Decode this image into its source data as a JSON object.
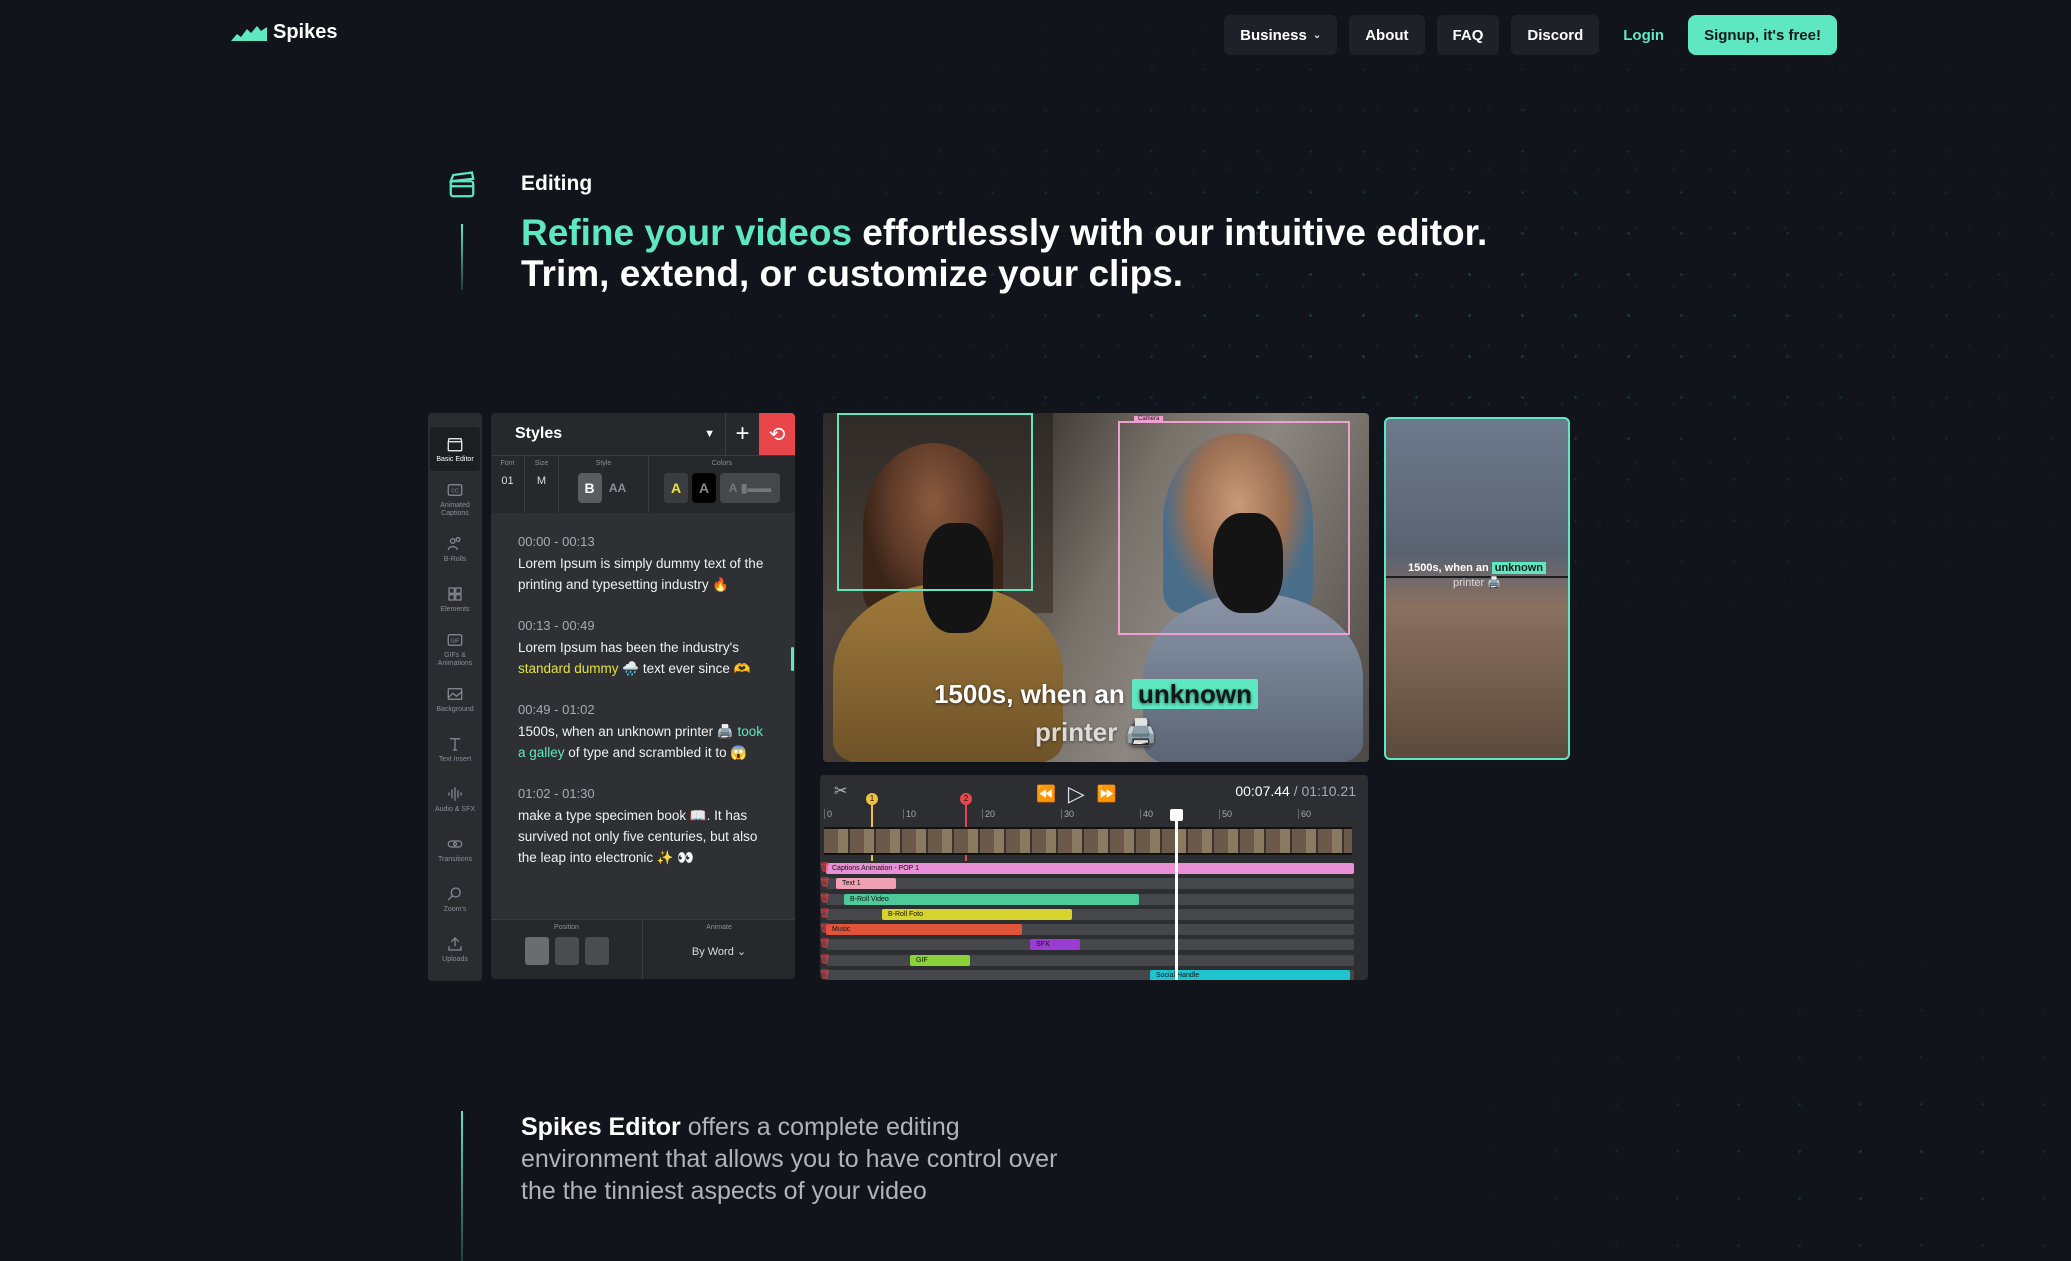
{
  "brand": {
    "name": "Spikes",
    "accent": "#5ee8c1"
  },
  "nav": {
    "business": "Business",
    "about": "About",
    "faq": "FAQ",
    "discord": "Discord",
    "login": "Login",
    "signup": "Signup, it's free!"
  },
  "hero": {
    "eyebrow": "Editing",
    "headline_accent": "Refine your videos",
    "headline_rest": " effortlessly with our intuitive editor.",
    "headline_line2": "Trim, extend, or customize your clips."
  },
  "sidebar": [
    {
      "label": "Basic Editor",
      "icon": "clapper-icon"
    },
    {
      "label": "Animated Captions",
      "icon": "cc-icon"
    },
    {
      "label": "B-Rolls",
      "icon": "people-icon"
    },
    {
      "label": "Elements",
      "icon": "grid-icon"
    },
    {
      "label": "GIFs & Animations",
      "icon": "gif-icon"
    },
    {
      "label": "Background",
      "icon": "image-icon"
    },
    {
      "label": "Text Insert",
      "icon": "text-icon"
    },
    {
      "label": "Audio & SFX",
      "icon": "audio-icon"
    },
    {
      "label": "Transitions",
      "icon": "transition-icon"
    },
    {
      "label": "Zoom's",
      "icon": "zoom-icon"
    },
    {
      "label": "Uploads",
      "icon": "upload-icon"
    }
  ],
  "styles_panel": {
    "title": "Styles",
    "font_label": "Font",
    "font_value": "01",
    "size_label": "Size",
    "size_value": "M",
    "style_label": "Style",
    "bold": "B",
    "caps": "AA",
    "colors_label": "Colors",
    "color_a": "A",
    "position_label": "Position",
    "animate_label": "Animate",
    "animate_value": "By Word"
  },
  "captions": [
    {
      "time": "00:00 - 00:13",
      "text": "Lorem Ipsum is simply dummy text of the printing and typesetting industry 🔥"
    },
    {
      "time": "00:13 - 00:49",
      "pre": "Lorem Ipsum has been the industry's ",
      "hl": "standard dummy",
      "post": " 🌧️ text ever since 🫶"
    },
    {
      "time": "00:49 - 01:02",
      "pre": "1500s, when an unknown printer 🖨️ ",
      "hl": "took a galley",
      "post": " of type and scrambled it to 😱"
    },
    {
      "time": "01:02 - 01:30",
      "text": "make a type specimen book 📖. It has survived not only five centuries, but also the leap into electronic ✨ 👀"
    }
  ],
  "preview": {
    "cam_label": "Camera",
    "subtitle_pre": "1500s, when an ",
    "subtitle_hl": "unknown",
    "subtitle_line2": "printer 🖨️"
  },
  "timeline": {
    "current": "00:07.44",
    "total": "01:10.21",
    "ticks": [
      "0",
      "10",
      "20",
      "30",
      "40",
      "50",
      "60"
    ],
    "markers": [
      "1",
      "2"
    ],
    "tracks": [
      {
        "name": "Captions Animation - POP 1",
        "color": "#e88fd6"
      },
      {
        "name": "Text 1",
        "color": "#f0a0b4"
      },
      {
        "name": "B-Roll Video",
        "color": "#4ec99a"
      },
      {
        "name": "B-Roll Foto",
        "color": "#d6d22e"
      },
      {
        "name": "Music",
        "color": "#e0553a"
      },
      {
        "name": "SFX",
        "color": "#9a3dd1"
      },
      {
        "name": "GIF",
        "color": "#8bd13a"
      },
      {
        "name": "Social Handle",
        "color": "#1fc4d1"
      }
    ]
  },
  "bottom": {
    "bold": "Spikes Editor",
    "rest": " offers a complete editing environment that allows you to have control over the the tinniest aspects of your video"
  }
}
